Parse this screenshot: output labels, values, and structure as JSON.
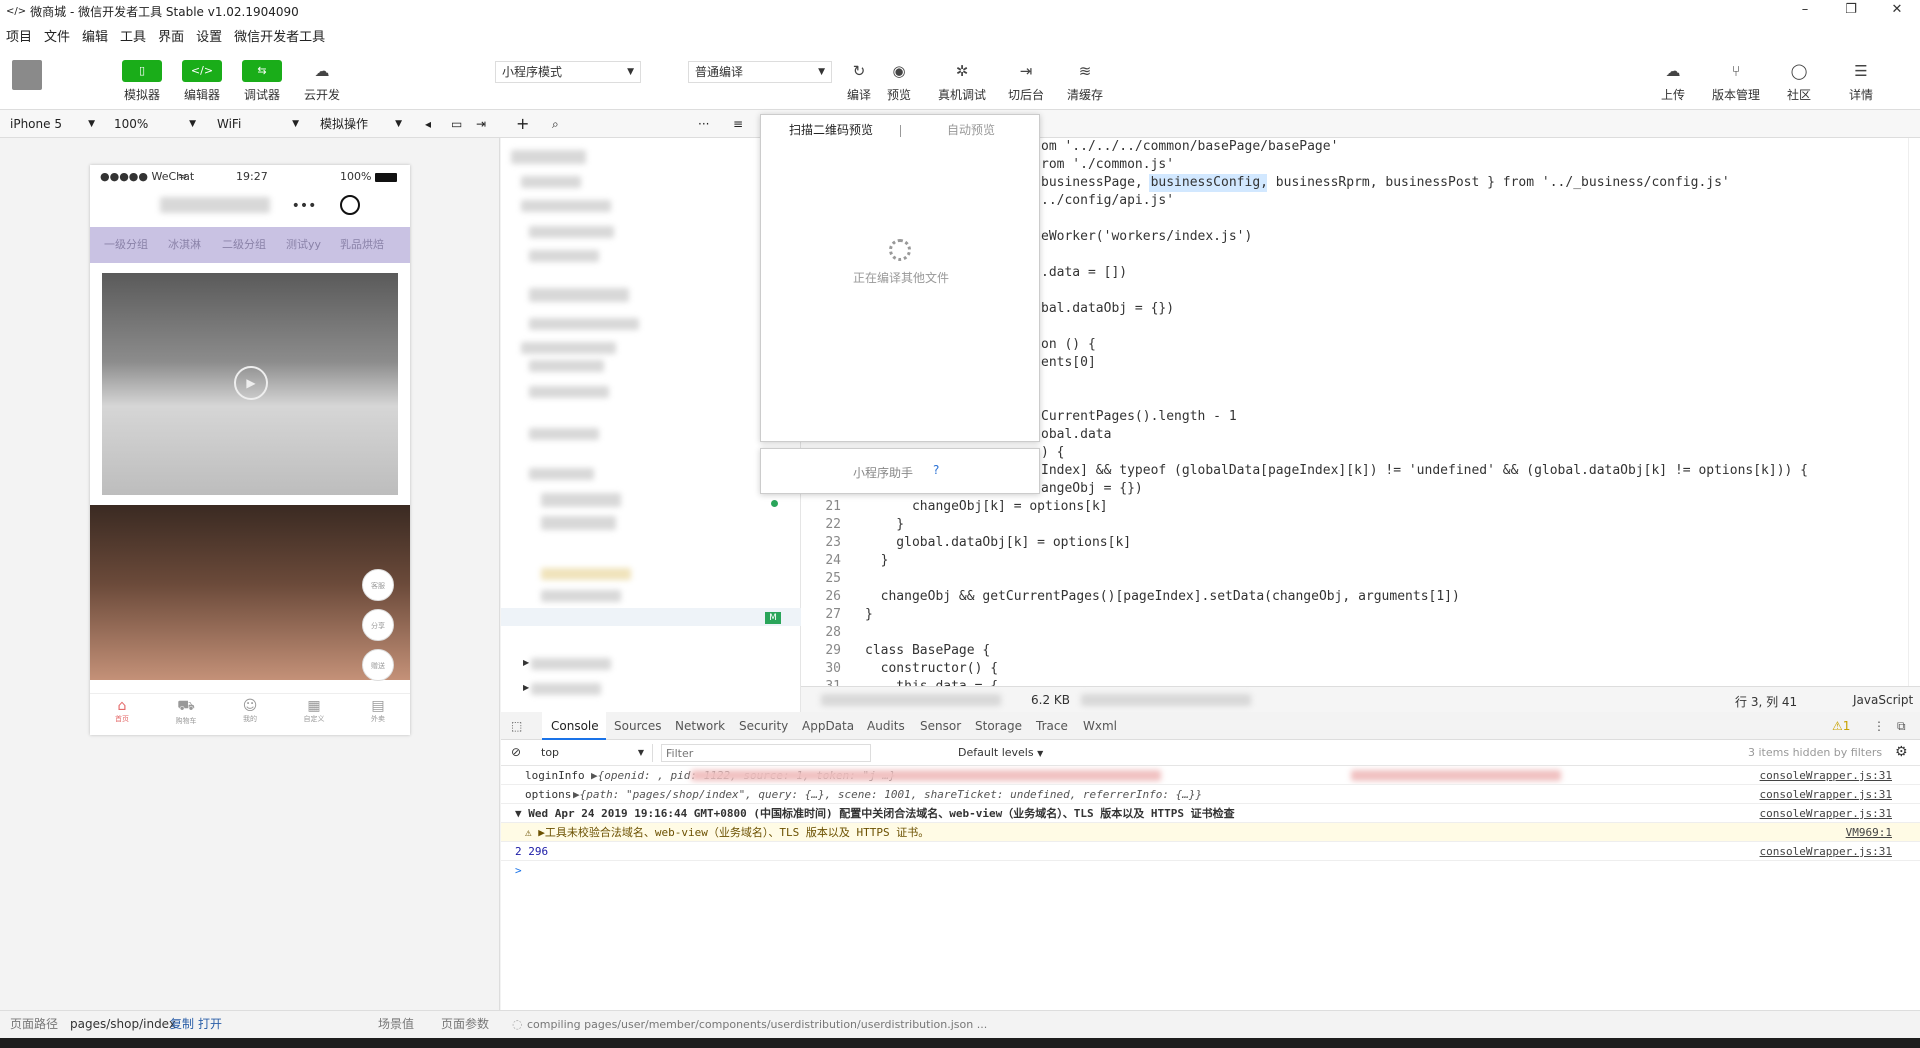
{
  "window": {
    "title": "微商城 - 微信开发者工具 Stable v1.02.1904090"
  },
  "menu": [
    "项目",
    "文件",
    "编辑",
    "工具",
    "界面",
    "设置",
    "微信开发者工具"
  ],
  "toolbar": {
    "simulator": "模拟器",
    "editor": "编辑器",
    "debugger": "调试器",
    "cloud": "云开发",
    "mode_select": "小程序模式",
    "compile_select": "普通编译",
    "compile": "编译",
    "preview": "预览",
    "real_debug": "真机调试",
    "background": "切后台",
    "clear_cache": "清缓存",
    "upload": "上传",
    "version": "版本管理",
    "community": "社区",
    "details": "详情"
  },
  "devbar": {
    "device": "iPhone 5",
    "zoom": "100%",
    "network": "WiFi",
    "simulate": "模拟操作"
  },
  "phone": {
    "carrier": "●●●●● WeChat",
    "time": "19:27",
    "battery": "100%",
    "tabs": [
      "一级分组",
      "冰淇淋",
      "二级分组",
      "测试yy",
      "乳品烘焙"
    ],
    "float_buttons": [
      "客服",
      "分享",
      "赠送"
    ],
    "bottom_tabs": [
      "首页",
      "购物车",
      "我的",
      "自定义",
      "外卖"
    ]
  },
  "popup": {
    "tab_qr": "扫描二维码预览",
    "tab_auto": "自动预览",
    "loading": "正在编译其他文件",
    "assistant": "小程序助手",
    "help": "?"
  },
  "editor": {
    "lines": [
      {
        "n": "",
        "code": "om '../../../common/basePage/basePage'"
      },
      {
        "n": "",
        "code": "rom './common.js'"
      },
      {
        "n": "",
        "code": "businessPage, businessConfig, businessRprm, businessPost } from '../_business/config.js'"
      },
      {
        "n": "",
        "code": "../config/api.js'"
      },
      {
        "n": "",
        "code": ""
      },
      {
        "n": "",
        "code": "eWorker('workers/index.js')"
      },
      {
        "n": "",
        "code": ""
      },
      {
        "n": "",
        "code": ".data = [])"
      },
      {
        "n": "",
        "code": ""
      },
      {
        "n": "",
        "code": "bal.dataObj = {})"
      },
      {
        "n": "",
        "code": ""
      },
      {
        "n": "",
        "code": "on () {"
      },
      {
        "n": "",
        "code": "ents[0]"
      },
      {
        "n": "",
        "code": ""
      },
      {
        "n": "",
        "code": ""
      },
      {
        "n": "",
        "code": "CurrentPages().length - 1"
      },
      {
        "n": "",
        "code": "obal.data"
      },
      {
        "n": "",
        "code": ") {"
      },
      {
        "n": "",
        "code": "Index] && typeof (globalData[pageIndex][k]) != 'undefined' && (global.dataObj[k] != options[k])) {"
      },
      {
        "n": "",
        "code": "angeObj = {})"
      },
      {
        "n": "21",
        "code": "      changeObj[k] = options[k]"
      },
      {
        "n": "22",
        "code": "    }"
      },
      {
        "n": "23",
        "code": "    global.dataObj[k] = options[k]"
      },
      {
        "n": "24",
        "code": "  }"
      },
      {
        "n": "25",
        "code": ""
      },
      {
        "n": "26",
        "code": "  changeObj && getCurrentPages()[pageIndex].setData(changeObj, arguments[1])"
      },
      {
        "n": "27",
        "code": "}"
      },
      {
        "n": "28",
        "code": ""
      },
      {
        "n": "29",
        "code": "class BasePage {"
      },
      {
        "n": "30",
        "code": "  constructor() {"
      },
      {
        "n": "31",
        "code": "    this.data = {"
      }
    ],
    "size": "6.2 KB",
    "position": "行 3, 列 41",
    "language": "JavaScript"
  },
  "devtools": {
    "tabs": [
      "Console",
      "Sources",
      "Network",
      "Security",
      "AppData",
      "Audits",
      "Sensor",
      "Storage",
      "Trace",
      "Wxml"
    ],
    "warnings": "⚠1",
    "context": "top",
    "filter_placeholder": "Filter",
    "levels": "Default levels",
    "hidden": "3 items hidden by filters"
  },
  "console": [
    {
      "label": "loginInfo",
      "text": "▶{openid:                                                              , pid: 1122, source: 1, token: \"j                                        …}",
      "src": "consoleWrapper.js:31"
    },
    {
      "label": "options",
      "text": "▶{path: \"pages/shop/index\", query: {…}, scene: 1001, shareTicket: undefined, referrerInfo: {…}}",
      "src": "consoleWrapper.js:31"
    },
    {
      "label": "▼ Wed Apr 24 2019 19:16:44 GMT+0800 (中国标准时间) 配置中关闭合法域名、web-view（业务域名）、TLS 版本以及 HTTPS 证书检查",
      "text": "",
      "src": "consoleWrapper.js:31"
    },
    {
      "label": "⚠ ▶工具未校验合法域名、web-view（业务域名）、TLS 版本以及 HTTPS 证书。",
      "text": "",
      "src": "VM969:1"
    },
    {
      "label": "2  296",
      "text": "",
      "src": "consoleWrapper.js:31"
    },
    {
      "label": ">",
      "text": "",
      "src": ""
    }
  ],
  "statusbar": {
    "path_label": "页面路径",
    "path": "pages/shop/index",
    "copy": "复制",
    "open": "打开",
    "scene": "场景值",
    "params": "页面参数",
    "compiling": "compiling pages/user/member/components/userdistribution/userdistribution.json ..."
  },
  "colors": {
    "green": "#1aad19",
    "purple_tabs": "#c9c2e3"
  }
}
